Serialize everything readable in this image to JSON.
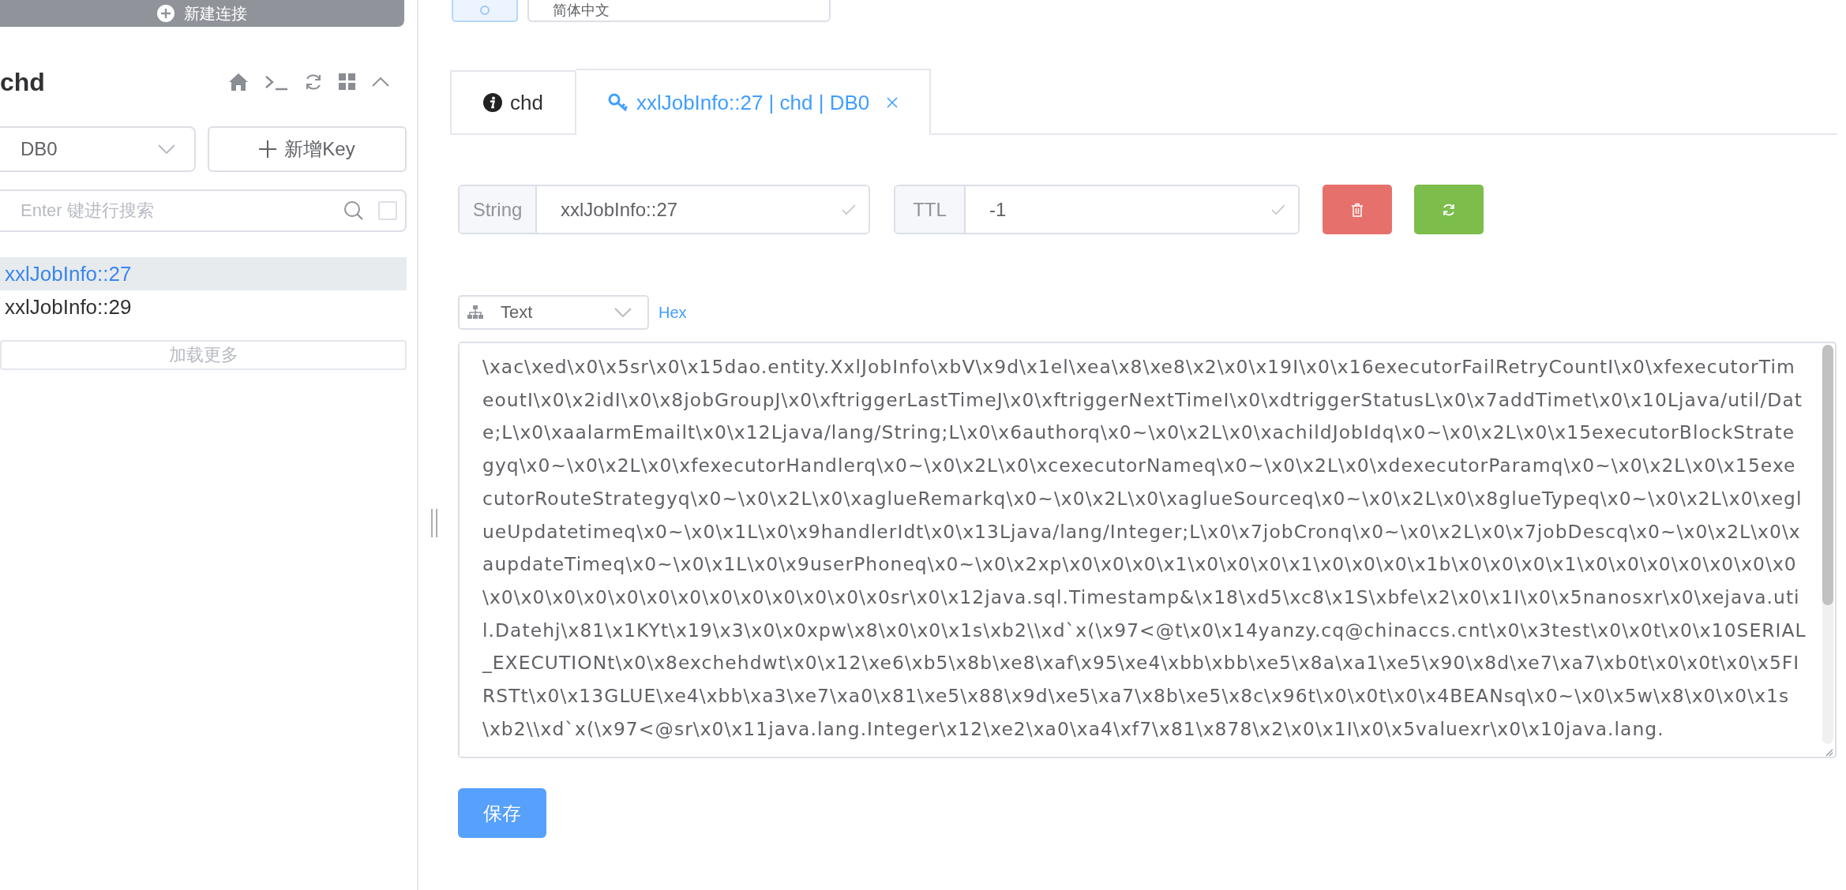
{
  "sidebar": {
    "new_connection_button": "新建连接",
    "connection_name": "chd",
    "db_select": {
      "value": "DB0"
    },
    "add_key_button": "新增Key",
    "search": {
      "placeholder": "Enter 键进行搜索",
      "exact_checked": false
    },
    "keys": [
      {
        "label": "xxlJobInfo::27",
        "selected": true
      },
      {
        "label": "xxlJobInfo::29",
        "selected": false
      }
    ],
    "load_more_button": "加载更多"
  },
  "top_bar": {
    "language_select": "简体中文"
  },
  "tabs": [
    {
      "kind": "info",
      "label": "chd",
      "selected": false,
      "closable": false
    },
    {
      "kind": "key",
      "label": "xxlJobInfo::27 | chd | DB0",
      "selected": true,
      "closable": true
    }
  ],
  "key_header": {
    "type": "String",
    "key_name": "xxlJobInfo::27",
    "ttl_label": "TTL",
    "ttl": "-1"
  },
  "viewer": {
    "format": "Text",
    "hex_link": "Hex",
    "value": "\\xac\\xed\\x0\\x5sr\\x0\\x15dao.entity.XxlJobInfo\\xbV\\x9d\\x1el\\xea\\x8\\xe8\\x2\\x0\\x19I\\x0\\x16executorFailRetryCountI\\x0\\xfexecutorTimeoutI\\x0\\x2idI\\x0\\x8jobGroupJ\\x0\\xftriggerLastTimeJ\\x0\\xftriggerNextTimeI\\x0\\xdtriggerStatusL\\x0\\x7addTimet\\x0\\x10Ljava/util/Date;L\\x0\\xaalarmEmailt\\x0\\x12Ljava/lang/String;L\\x0\\x6authorq\\x0~\\x0\\x2L\\x0\\xachildJobIdq\\x0~\\x0\\x2L\\x0\\x15executorBlockStrategyq\\x0~\\x0\\x2L\\x0\\xfexecutorHandlerq\\x0~\\x0\\x2L\\x0\\xcexecutorNameq\\x0~\\x0\\x2L\\x0\\xdexecutorParamq\\x0~\\x0\\x2L\\x0\\x15executorRouteStrategyq\\x0~\\x0\\x2L\\x0\\xaglueRemarkq\\x0~\\x0\\x2L\\x0\\xaglueSourceq\\x0~\\x0\\x2L\\x0\\x8glueTypeq\\x0~\\x0\\x2L\\x0\\xeglueUpdatetimeq\\x0~\\x0\\x1L\\x0\\x9handlerIdt\\x0\\x13Ljava/lang/Integer;L\\x0\\x7jobCronq\\x0~\\x0\\x2L\\x0\\x7jobDescq\\x0~\\x0\\x2L\\x0\\xaupdateTimeq\\x0~\\x0\\x1L\\x0\\x9userPhoneq\\x0~\\x0\\x2xp\\x0\\x0\\x0\\x1\\x0\\x0\\x0\\x1\\x0\\x0\\x0\\x1b\\x0\\x0\\x0\\x1\\x0\\x0\\x0\\x0\\x0\\x0\\x0\\x0\\x0\\x0\\x0\\x0\\x0\\x0\\x0\\x0\\x0\\x0\\x0\\x0sr\\x0\\x12java.sql.Timestamp&\\x18\\xd5\\xc8\\x1S\\xbfe\\x2\\x0\\x1I\\x0\\x5nanosxr\\x0\\xejava.util.Datehj\\x81\\x1KYt\\x19\\x3\\x0\\x0xpw\\x8\\x0\\x0\\x1s\\xb2\\\\xd`x(\\x97<@t\\x0\\x14yanzy.cq@chinaccs.cnt\\x0\\x3test\\x0\\x0t\\x0\\x10SERIAL_EXECUTIONt\\x0\\x8exchehdwt\\x0\\x12\\xe6\\xb5\\x8b\\xe8\\xaf\\x95\\xe4\\xbb\\xbb\\xe5\\x8a\\xa1\\xe5\\x90\\x8d\\xe7\\xa7\\xb0t\\x0\\x0t\\x0\\x5FIRSTt\\x0\\x13GLUE\\xe4\\xbb\\xa3\\xe7\\xa0\\x81\\xe5\\x88\\x9d\\xe5\\xa7\\x8b\\xe5\\x8c\\x96t\\x0\\x0t\\x0\\x4BEANsq\\x0~\\x0\\x5w\\x8\\x0\\x0\\x1s\\xb2\\\\xd`x(\\x97<@sr\\x0\\x11java.lang.Integer\\x12\\xe2\\xa0\\xa4\\xf7\\x81\\x878\\x2\\x0\\x1I\\x0\\x5valuexr\\x0\\x10java.lang."
  },
  "save_button": "保存"
}
